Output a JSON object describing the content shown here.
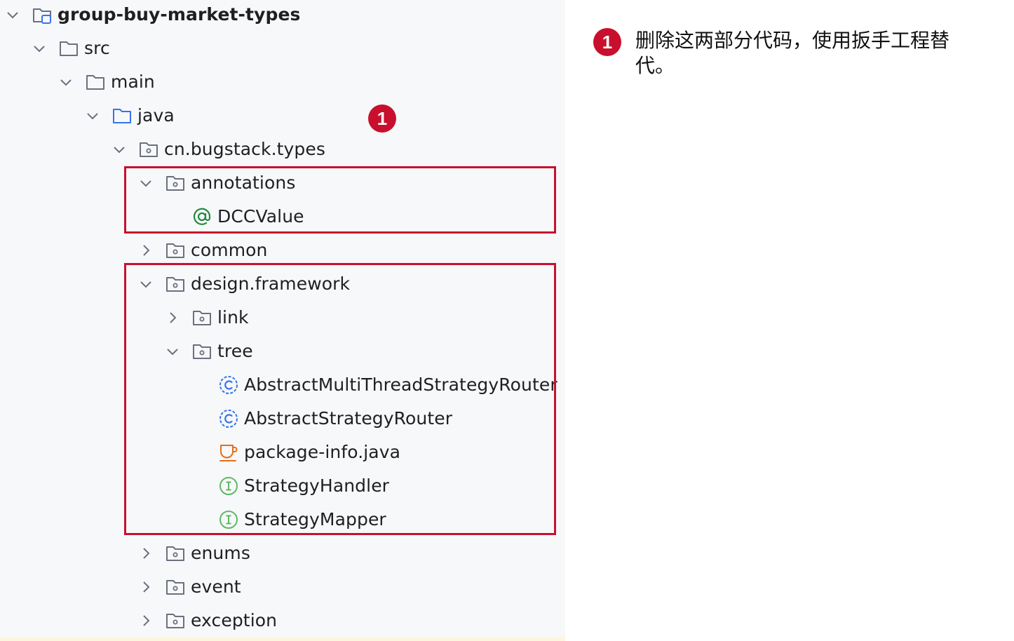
{
  "tree": {
    "items": [
      {
        "label": "group-buy-market-types",
        "icon": "module-folder-icon",
        "chevron": "down"
      },
      {
        "label": "src",
        "icon": "folder-icon",
        "chevron": "down"
      },
      {
        "label": "main",
        "icon": "folder-icon",
        "chevron": "down"
      },
      {
        "label": "java",
        "icon": "source-folder-icon",
        "chevron": "down"
      },
      {
        "label": "cn.bugstack.types",
        "icon": "package-icon",
        "chevron": "down"
      },
      {
        "label": "annotations",
        "icon": "package-icon",
        "chevron": "down"
      },
      {
        "label": "DCCValue",
        "icon": "annotation-icon",
        "chevron": "none"
      },
      {
        "label": "common",
        "icon": "package-icon",
        "chevron": "right"
      },
      {
        "label": "design.framework",
        "icon": "package-icon",
        "chevron": "down"
      },
      {
        "label": "link",
        "icon": "package-icon",
        "chevron": "right"
      },
      {
        "label": "tree",
        "icon": "package-icon",
        "chevron": "down"
      },
      {
        "label": "AbstractMultiThreadStrategyRouter",
        "icon": "abstract-class-icon",
        "chevron": "none"
      },
      {
        "label": "AbstractStrategyRouter",
        "icon": "abstract-class-icon",
        "chevron": "none"
      },
      {
        "label": "package-info.java",
        "icon": "java-file-icon",
        "chevron": "none"
      },
      {
        "label": "StrategyHandler",
        "icon": "interface-icon",
        "chevron": "none"
      },
      {
        "label": "StrategyMapper",
        "icon": "interface-icon",
        "chevron": "none"
      },
      {
        "label": "enums",
        "icon": "package-icon",
        "chevron": "right"
      },
      {
        "label": "event",
        "icon": "package-icon",
        "chevron": "right"
      },
      {
        "label": "exception",
        "icon": "package-icon",
        "chevron": "right"
      }
    ]
  },
  "annotation": {
    "marker": "1",
    "note": "删除这两部分代码，使用扳手工程替代。"
  },
  "colors": {
    "highlight": "#c8102e",
    "panel_bg": "#f7f8fa",
    "folder_stroke": "#6c707e",
    "source_folder": "#3574f0",
    "annotation_green": "#208a3c",
    "interface_green": "#5fb865",
    "class_blue": "#3574f0",
    "java_orange": "#e66d17"
  }
}
